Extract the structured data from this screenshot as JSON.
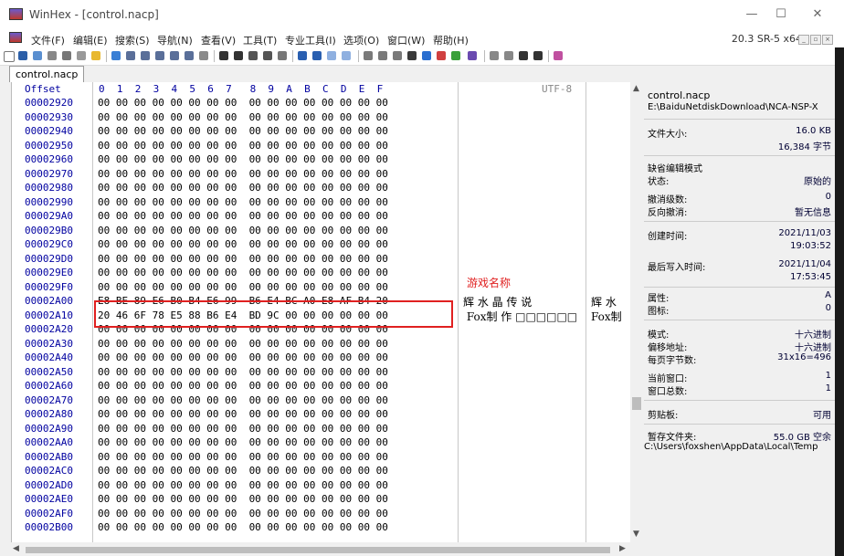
{
  "window": {
    "title": "WinHex - [control.nacp]",
    "minimize": "—",
    "maximize": "☐",
    "close": "✕"
  },
  "menu": {
    "items": [
      "文件(F)",
      "编辑(E)",
      "搜索(S)",
      "导航(N)",
      "查看(V)",
      "工具(T)",
      "专业工具(I)",
      "选项(O)",
      "窗口(W)",
      "帮助(H)"
    ],
    "version": "20.3 SR-5 x64"
  },
  "tab": {
    "label": "control.nacp"
  },
  "hex": {
    "header_offset": "Offset",
    "header_hex": "0  1  2  3  4  5  6  7   8  9  A  B  C  D  E  F",
    "header_text": "UTF-8",
    "rows": [
      {
        "offset": "00002920",
        "hex": "00 00 00 00 00 00 00 00  00 00 00 00 00 00 00 00",
        "text": "",
        "text2": ""
      },
      {
        "offset": "00002930",
        "hex": "00 00 00 00 00 00 00 00  00 00 00 00 00 00 00 00",
        "text": "",
        "text2": ""
      },
      {
        "offset": "00002940",
        "hex": "00 00 00 00 00 00 00 00  00 00 00 00 00 00 00 00",
        "text": "",
        "text2": ""
      },
      {
        "offset": "00002950",
        "hex": "00 00 00 00 00 00 00 00  00 00 00 00 00 00 00 00",
        "text": "",
        "text2": ""
      },
      {
        "offset": "00002960",
        "hex": "00 00 00 00 00 00 00 00  00 00 00 00 00 00 00 00",
        "text": "",
        "text2": ""
      },
      {
        "offset": "00002970",
        "hex": "00 00 00 00 00 00 00 00  00 00 00 00 00 00 00 00",
        "text": "",
        "text2": ""
      },
      {
        "offset": "00002980",
        "hex": "00 00 00 00 00 00 00 00  00 00 00 00 00 00 00 00",
        "text": "",
        "text2": ""
      },
      {
        "offset": "00002990",
        "hex": "00 00 00 00 00 00 00 00  00 00 00 00 00 00 00 00",
        "text": "",
        "text2": ""
      },
      {
        "offset": "000029A0",
        "hex": "00 00 00 00 00 00 00 00  00 00 00 00 00 00 00 00",
        "text": "",
        "text2": ""
      },
      {
        "offset": "000029B0",
        "hex": "00 00 00 00 00 00 00 00  00 00 00 00 00 00 00 00",
        "text": "",
        "text2": ""
      },
      {
        "offset": "000029C0",
        "hex": "00 00 00 00 00 00 00 00  00 00 00 00 00 00 00 00",
        "text": "",
        "text2": ""
      },
      {
        "offset": "000029D0",
        "hex": "00 00 00 00 00 00 00 00  00 00 00 00 00 00 00 00",
        "text": "",
        "text2": ""
      },
      {
        "offset": "000029E0",
        "hex": "00 00 00 00 00 00 00 00  00 00 00 00 00 00 00 00",
        "text": "",
        "text2": ""
      },
      {
        "offset": "000029F0",
        "hex": "00 00 00 00 00 00 00 00  00 00 00 00 00 00 00 00",
        "text": "",
        "text2": ""
      },
      {
        "offset": "00002A00",
        "hex": "E8 BE 89 E6 B0 B4 E6 99  B6 E4 BC A0 E8 AF B4 20",
        "text": "辉 水 晶 传 说",
        "text2": "辉 水"
      },
      {
        "offset": "00002A10",
        "hex": "20 46 6F 78 E5 88 B6 E4  BD 9C 00 00 00 00 00 00",
        "text": " Fox制 作 □□□□□□",
        "text2": "Fox制"
      },
      {
        "offset": "00002A20",
        "hex": "00 00 00 00 00 00 00 00  00 00 00 00 00 00 00 00",
        "text": "",
        "text2": ""
      },
      {
        "offset": "00002A30",
        "hex": "00 00 00 00 00 00 00 00  00 00 00 00 00 00 00 00",
        "text": "",
        "text2": ""
      },
      {
        "offset": "00002A40",
        "hex": "00 00 00 00 00 00 00 00  00 00 00 00 00 00 00 00",
        "text": "",
        "text2": ""
      },
      {
        "offset": "00002A50",
        "hex": "00 00 00 00 00 00 00 00  00 00 00 00 00 00 00 00",
        "text": "",
        "text2": ""
      },
      {
        "offset": "00002A60",
        "hex": "00 00 00 00 00 00 00 00  00 00 00 00 00 00 00 00",
        "text": "",
        "text2": ""
      },
      {
        "offset": "00002A70",
        "hex": "00 00 00 00 00 00 00 00  00 00 00 00 00 00 00 00",
        "text": "",
        "text2": ""
      },
      {
        "offset": "00002A80",
        "hex": "00 00 00 00 00 00 00 00  00 00 00 00 00 00 00 00",
        "text": "",
        "text2": ""
      },
      {
        "offset": "00002A90",
        "hex": "00 00 00 00 00 00 00 00  00 00 00 00 00 00 00 00",
        "text": "",
        "text2": ""
      },
      {
        "offset": "00002AA0",
        "hex": "00 00 00 00 00 00 00 00  00 00 00 00 00 00 00 00",
        "text": "",
        "text2": ""
      },
      {
        "offset": "00002AB0",
        "hex": "00 00 00 00 00 00 00 00  00 00 00 00 00 00 00 00",
        "text": "",
        "text2": ""
      },
      {
        "offset": "00002AC0",
        "hex": "00 00 00 00 00 00 00 00  00 00 00 00 00 00 00 00",
        "text": "",
        "text2": ""
      },
      {
        "offset": "00002AD0",
        "hex": "00 00 00 00 00 00 00 00  00 00 00 00 00 00 00 00",
        "text": "",
        "text2": ""
      },
      {
        "offset": "00002AE0",
        "hex": "00 00 00 00 00 00 00 00  00 00 00 00 00 00 00 00",
        "text": "",
        "text2": ""
      },
      {
        "offset": "00002AF0",
        "hex": "00 00 00 00 00 00 00 00  00 00 00 00 00 00 00 00",
        "text": "",
        "text2": ""
      },
      {
        "offset": "00002B00",
        "hex": "00 00 00 00 00 00 00 00  00 00 00 00 00 00 00 00",
        "text": "",
        "text2": ""
      }
    ]
  },
  "annotation": {
    "label": "游戏名称",
    "color": "#e02020"
  },
  "info": {
    "filename": "control.nacp",
    "path": "E:\\BaiduNetdiskDownload\\NCA-NSP-X",
    "size_label": "文件大小:",
    "size_kb": "16.0 KB",
    "size_bytes": "16,384 字节",
    "edit_mode_label": "缺省编辑模式",
    "state_label": "状态:",
    "state_value": "原始的",
    "undo_label": "撤消级数:",
    "undo_value": "0",
    "redo_label": "反向撤消:",
    "redo_value": "暂无信息",
    "created_label": "创建时间:",
    "created_date": "2021/11/03",
    "created_time": "19:03:52",
    "modified_label": "最后写入时间:",
    "modified_date": "2021/11/04",
    "modified_time": "17:53:45",
    "attr_label": "属性:",
    "attr_value": "A",
    "icon_label": "图标:",
    "icon_value": "0",
    "mode_label": "模式:",
    "mode_value": "十六进制",
    "offset_label": "偏移地址:",
    "offset_value": "十六进制",
    "bpp_label": "每页字节数:",
    "bpp_value": "31x16=496",
    "curwin_label": "当前窗口:",
    "curwin_value": "1",
    "totalwin_label": "窗口总数:",
    "totalwin_value": "1",
    "clip_label": "剪贴板:",
    "clip_value": "可用",
    "temp_label": "暂存文件夹:",
    "temp_value": "55.0 GB 空余",
    "temp_path": "C:\\Users\\foxshen\\AppData\\Local\\Temp"
  }
}
